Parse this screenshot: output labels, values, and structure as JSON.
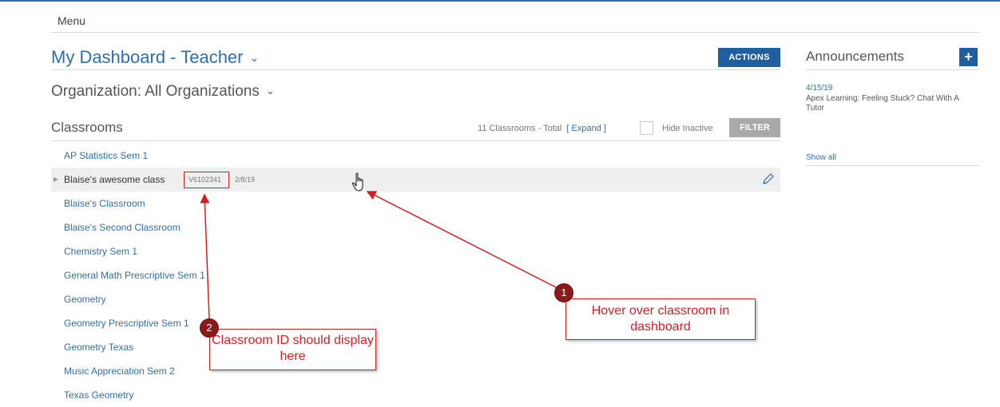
{
  "menu": {
    "label": "Menu"
  },
  "dashboard": {
    "title": "My Dashboard - Teacher",
    "chevron": "⌄",
    "actions_label": "ACTIONS"
  },
  "organization": {
    "title": "Organization: All Organizations",
    "chevron": "⌄"
  },
  "classrooms": {
    "heading": "Classrooms",
    "count_text": "11 Classrooms - Total",
    "expand_label": "[ Expand ]",
    "hide_inactive_label": "Hide Inactive",
    "filter_label": "FILTER",
    "items": [
      {
        "name": "AP Statistics Sem 1"
      },
      {
        "name": "Blaise's awesome class",
        "code": "V6102341",
        "date": "2/8/19",
        "hovered": true
      },
      {
        "name": "Blaise's Classroom"
      },
      {
        "name": "Blaise's Second Classroom"
      },
      {
        "name": "Chemistry Sem 1"
      },
      {
        "name": "General Math Prescriptive Sem 1"
      },
      {
        "name": "Geometry"
      },
      {
        "name": "Geometry Prescriptive Sem 1"
      },
      {
        "name": "Geometry Texas"
      },
      {
        "name": "Music Appreciation Sem 2"
      },
      {
        "name": "Texas Geometry"
      }
    ]
  },
  "announcements": {
    "heading": "Announcements",
    "add_label": "+",
    "items": [
      {
        "date": "4/15/19",
        "text": "Apex Learning: Feeling Stuck? Chat With A Tutor"
      }
    ],
    "show_all_label": "Show all"
  },
  "callouts": [
    {
      "number": "1",
      "text": "Hover over classroom in dashboard"
    },
    {
      "number": "2",
      "text": "Classroom ID should display here"
    }
  ],
  "colors": {
    "accent": "#2f6fad",
    "button": "#1f5f9f",
    "filter_button": "#a9a9a9",
    "annotation_red": "#d41f1f",
    "badge": "#8b1a1a"
  },
  "icons": {
    "edit": "pencil-icon",
    "cursor": "hand-pointer-icon",
    "expand": "triangle-right-icon"
  }
}
